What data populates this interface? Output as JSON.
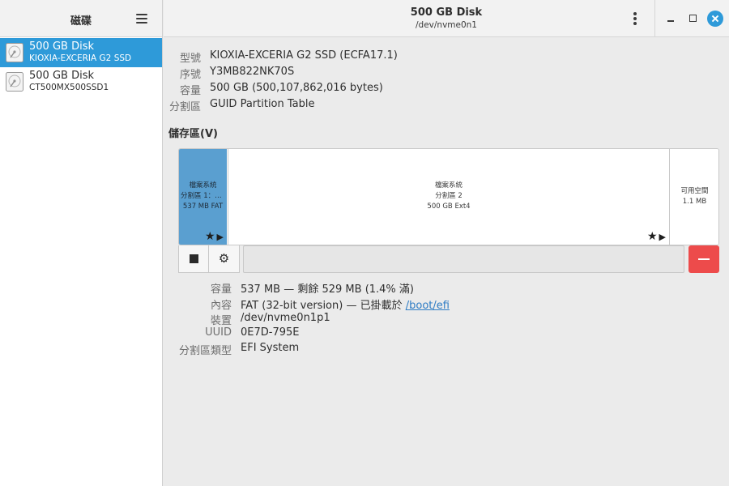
{
  "sidebar": {
    "title": "磁碟",
    "disks": [
      {
        "name": "500 GB Disk",
        "model": "KIOXIA-EXCERIA G2 SSD",
        "selected": true
      },
      {
        "name": "500 GB Disk",
        "model": "CT500MX500SSD1",
        "selected": false
      }
    ]
  },
  "header": {
    "title": "500 GB Disk",
    "subtitle": "/dev/nvme0n1"
  },
  "drive": {
    "rows": [
      {
        "label": "型號",
        "value": "KIOXIA-EXCERIA G2 SSD (ECFA17.1)"
      },
      {
        "label": "序號",
        "value": "Y3MB822NK70S"
      },
      {
        "label": "容量",
        "value": "500 GB (500,107,862,016 bytes)"
      },
      {
        "label": "分割區",
        "value": "GUID Partition Table"
      }
    ]
  },
  "volumes": {
    "heading": "儲存區(V)",
    "partitions": [
      {
        "line1": "檔案系統",
        "line2": "分割區 1：E…",
        "line3": "537 MB FAT"
      },
      {
        "line1": "檔案系統",
        "line2": "分割區 2",
        "line3": "500 GB Ext4"
      },
      {
        "line1": "可用空間",
        "line2": "1.1 MB"
      }
    ],
    "part_icons": {
      "star": "★",
      "play": "▶"
    },
    "toolbar": {
      "stop": "stop-icon",
      "settings": "⚙"
    }
  },
  "details": {
    "rows": [
      {
        "label": "容量",
        "value": "537 MB — 剩餘 529 MB (1.4% 滿)"
      },
      {
        "label": "內容",
        "value": "FAT (32-bit version) — 已掛載於 ",
        "link": "/boot/efi"
      },
      {
        "label": "裝置",
        "value": "/dev/nvme0n1p1"
      },
      {
        "label": "UUID",
        "value": "0E7D-795E"
      },
      {
        "label": "分割區類型",
        "value": "EFI System"
      }
    ]
  },
  "colors": {
    "accent": "#2e9ad9",
    "partition_selected": "#5a9fd0",
    "delete": "#ed4b4b",
    "link": "#2e7cc4"
  }
}
